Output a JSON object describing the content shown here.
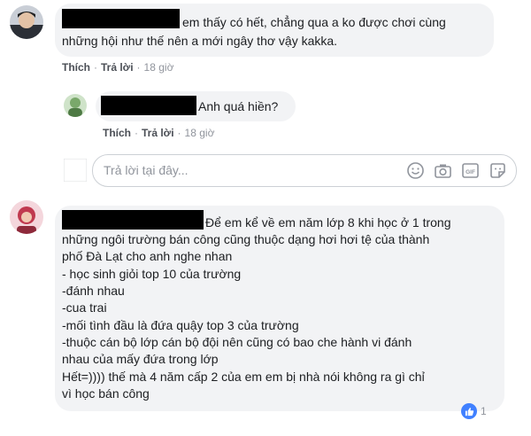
{
  "comments": [
    {
      "text_lines": [
        "em thấy có hết, chẳng qua a ko được chơi cùng",
        "những hội như thế nên a mới ngây thơ vậy kakka."
      ],
      "actions": {
        "like": "Thích",
        "reply": "Trả lời",
        "time": "18 giờ"
      }
    },
    {
      "text_lines": [
        "Anh quá hiền?"
      ],
      "actions": {
        "like": "Thích",
        "reply": "Trả lời",
        "time": "18 giờ"
      }
    },
    {
      "text_lines": [
        "Để em kể về em năm lớp 8 khi học ở 1 trong",
        "những ngôi trường bán công cũng thuộc dạng hơi hơi tệ của thành",
        "phố Đà Lạt cho anh nghe nhan",
        "- học sinh giỏi top 10 của trường",
        "-đánh nhau",
        "-cua trai",
        "-mối tình đầu là đứa quậy top 3 của trường",
        "-thuộc cán bộ lớp cán bộ đội nên cũng có bao che hành vi đánh",
        "nhau của mấy đứa trong lớp",
        "Hết=)))) thế mà 4 năm cấp 2 của em em bị nhà nói không ra gì chỉ",
        "vì học bán công"
      ],
      "reaction_count": "1"
    }
  ],
  "reply_box": {
    "placeholder": "Trả lời tại đây..."
  },
  "icons": [
    "smile-icon",
    "camera-icon",
    "gif-icon",
    "sticker-icon",
    "like-icon"
  ],
  "colors": {
    "bubble": "#f2f3f5",
    "action_text": "#4b4f56",
    "meta_text": "#90949c",
    "like_blue": "#4080ff"
  }
}
